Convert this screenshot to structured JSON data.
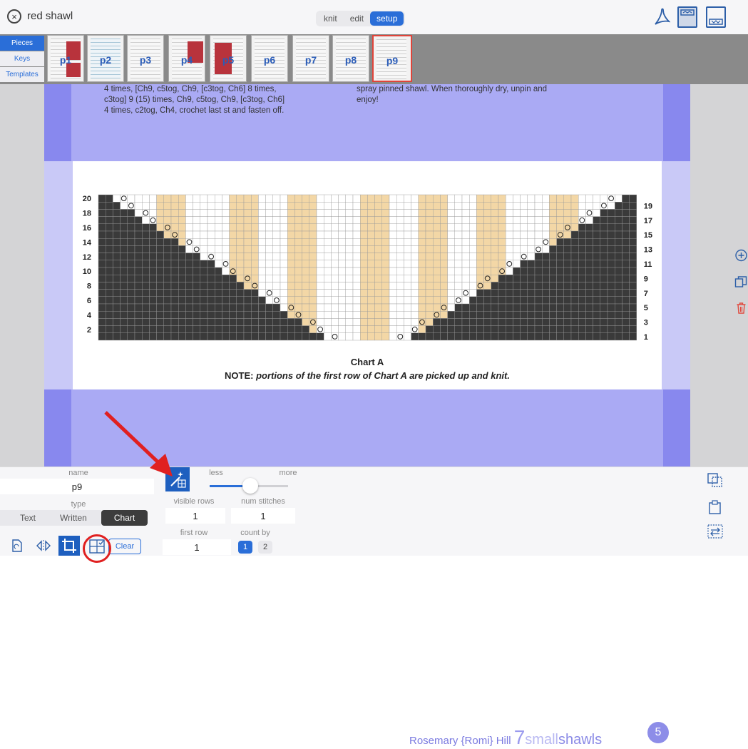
{
  "topbar": {
    "close_label": "×",
    "title": "red shawl",
    "modes": [
      "knit",
      "edit",
      "setup"
    ],
    "active_mode": "setup"
  },
  "strip": {
    "side_tabs": [
      "Pieces",
      "Keys",
      "Templates"
    ],
    "active_tab": "Pieces",
    "pieces": [
      "p1",
      "p2",
      "p3",
      "p4",
      "p5",
      "p6",
      "p7",
      "p8",
      "p9"
    ],
    "selected_piece": "p9"
  },
  "document": {
    "text_left_1": "4 times, [Ch9, c5tog, Ch9, [c3tog, Ch6] 8 times,",
    "text_left_2": "c3tog] 9 (15) times, Ch9, c5tog, Ch9, [c3tog, Ch6]",
    "text_left_3": "4 times, c2tog, Ch4, crochet last st and fasten off.",
    "text_right_1": "spray pinned shawl. When thoroughly dry, unpin and",
    "text_right_2": "enjoy!",
    "chart_title": "Chart A",
    "note_prefix": "NOTE:",
    "note_text": "portions of the first row of Chart A are picked up and knit.",
    "left_row_numbers": [
      "20",
      "18",
      "16",
      "14",
      "12",
      "10",
      "8",
      "6",
      "4",
      "2"
    ],
    "right_row_numbers": [
      "19",
      "17",
      "15",
      "13",
      "11",
      "9",
      "7",
      "5",
      "3",
      "1"
    ],
    "footer_author": "Rosemary {Romi} Hill",
    "footer_brand_num": "7",
    "footer_brand_small": "small",
    "footer_brand_shawls": "shawls",
    "footer_badge": "5"
  },
  "bottom": {
    "name_label": "name",
    "name_value": "p9",
    "type_label": "type",
    "type_options": [
      "Text",
      "Written",
      "Chart"
    ],
    "type_selected": "Chart",
    "slider_less": "less",
    "slider_more": "more",
    "slider_value": 0.5,
    "visible_rows_label": "visible rows",
    "visible_rows_value": "1",
    "num_stitches_label": "num stitches",
    "num_stitches_value": "1",
    "first_row_label": "first row",
    "first_row_value": "1",
    "count_by_label": "count by",
    "count_by_options": [
      "1",
      "2"
    ],
    "count_by_selected": "1",
    "clear_label": "Clear"
  },
  "colors": {
    "accent": "#2a6ed8",
    "highlight_band": "#aaaaf4",
    "chart_dark": "#3a3a3a",
    "chart_tan": "#f3d7a6",
    "annotation_red": "#e02020"
  }
}
